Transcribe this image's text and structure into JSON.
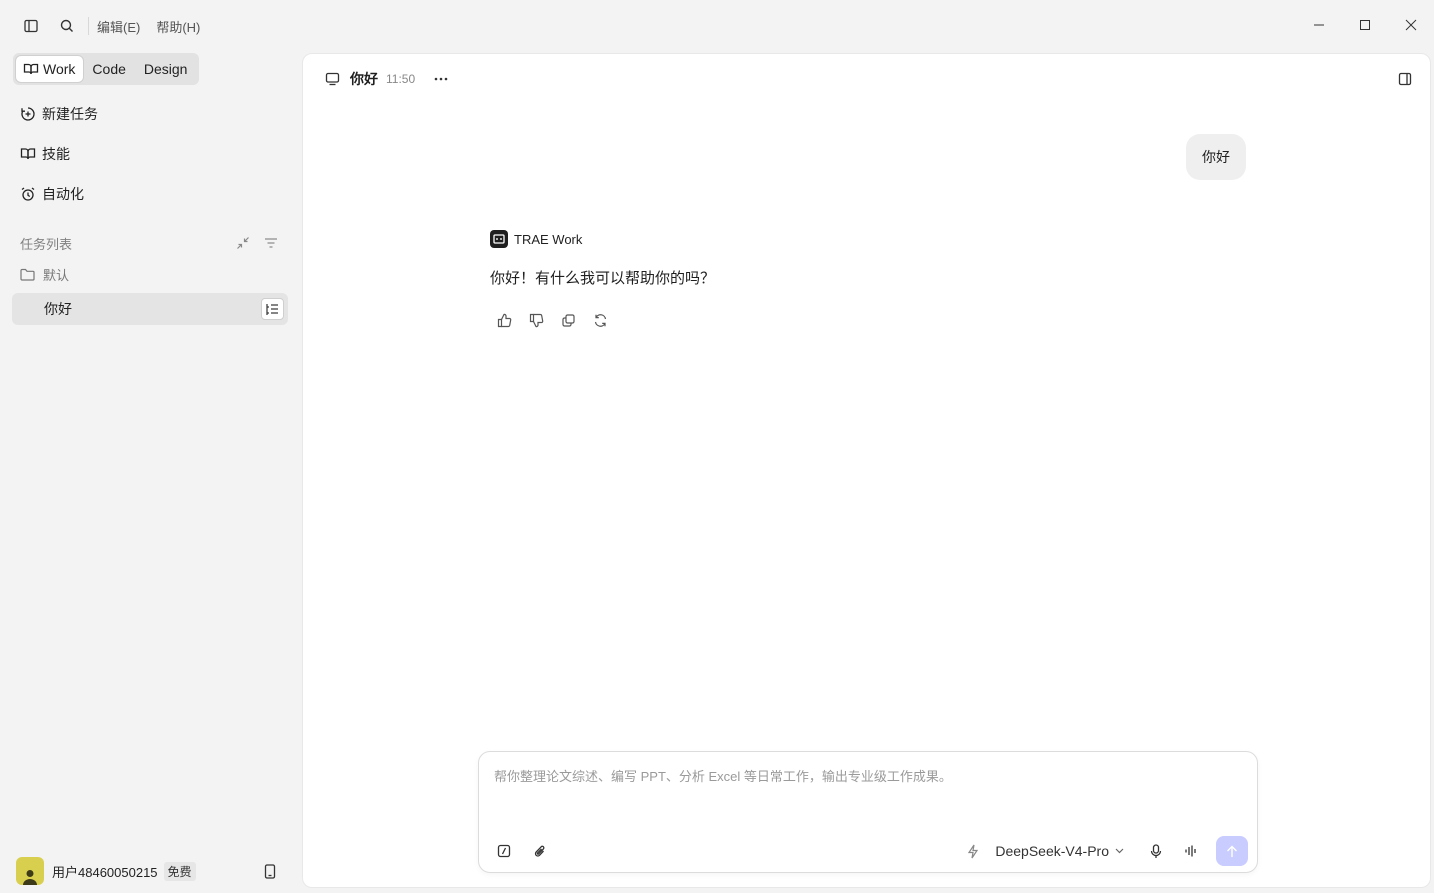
{
  "menu": {
    "edit": "编辑(E)",
    "help": "帮助(H)"
  },
  "modes": [
    {
      "label": "Work",
      "active": true
    },
    {
      "label": "Code",
      "active": false
    },
    {
      "label": "Design",
      "active": false
    }
  ],
  "nav": {
    "new_task": "新建任务",
    "skills": "技能",
    "automation": "自动化"
  },
  "tasks": {
    "header": "任务列表",
    "folder": "默认",
    "items": [
      {
        "label": "你好",
        "selected": true
      }
    ]
  },
  "user": {
    "name": "用户48460050215",
    "plan": "免费"
  },
  "conversation": {
    "title": "你好",
    "time": "11:50",
    "user_message": "你好",
    "assistant_name": "TRAE Work",
    "assistant_message": "你好！有什么我可以帮助你的吗？"
  },
  "composer": {
    "placeholder": "帮你整理论文综述、编写 PPT、分析 Excel 等日常工作，输出专业级工作成果。",
    "value": "",
    "model": "DeepSeek-V4-Pro"
  },
  "colors": {
    "send_button": "#c8ccff",
    "avatar": "#d9cf4e",
    "selected_task_bg": "#e4e4e4"
  }
}
